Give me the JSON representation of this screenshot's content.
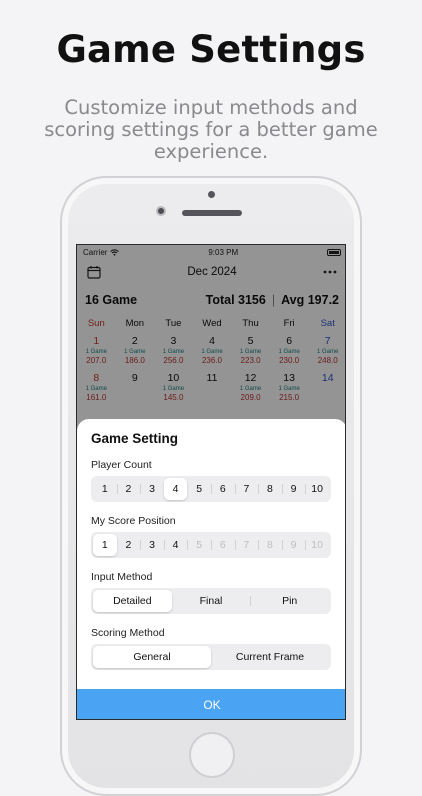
{
  "hero": {
    "title": "Game Settings",
    "subtitle": "Customize input methods and scoring settings for a better game experience."
  },
  "status_bar": {
    "carrier": "Carrier",
    "time": "9:03 PM"
  },
  "nav": {
    "month": "Dec 2024",
    "calendar_icon": "calendar-icon",
    "more_icon": "more-icon"
  },
  "summary": {
    "games": "16 Game",
    "total": "Total 3156",
    "separator": "|",
    "avg": "Avg 197.2"
  },
  "weekdays": [
    "Sun",
    "Mon",
    "Tue",
    "Wed",
    "Thu",
    "Fri",
    "Sat"
  ],
  "calendar_rows": [
    [
      {
        "day": "1",
        "games": "1 Game",
        "score": "207.0"
      },
      {
        "day": "2",
        "games": "1 Game",
        "score": "186.0"
      },
      {
        "day": "3",
        "games": "1 Game",
        "score": "256.0"
      },
      {
        "day": "4",
        "games": "1 Game",
        "score": "236.0"
      },
      {
        "day": "5",
        "games": "1 Game",
        "score": "223.0"
      },
      {
        "day": "6",
        "games": "1 Game",
        "score": "230.0"
      },
      {
        "day": "7",
        "games": "1 Game",
        "score": "248.0"
      }
    ],
    [
      {
        "day": "8",
        "games": "1 Game",
        "score": "161.0"
      },
      {
        "day": "9",
        "games": "",
        "score": ""
      },
      {
        "day": "10",
        "games": "1 Game",
        "score": "145.0"
      },
      {
        "day": "11",
        "games": "",
        "score": ""
      },
      {
        "day": "12",
        "games": "1 Game",
        "score": "209.0"
      },
      {
        "day": "13",
        "games": "1 Game",
        "score": "215.0"
      },
      {
        "day": "14",
        "games": "",
        "score": ""
      }
    ]
  ],
  "sheet": {
    "title": "Game Setting",
    "player_count": {
      "label": "Player Count",
      "options": [
        "1",
        "2",
        "3",
        "4",
        "5",
        "6",
        "7",
        "8",
        "9",
        "10"
      ],
      "selected": "4"
    },
    "score_position": {
      "label": "My Score Position",
      "options": [
        "1",
        "2",
        "3",
        "4",
        "5",
        "6",
        "7",
        "8",
        "9",
        "10"
      ],
      "selected": "1",
      "enabled_up_to": "4"
    },
    "input_method": {
      "label": "Input Method",
      "options": [
        "Detailed",
        "Final",
        "Pin"
      ],
      "selected": "Detailed"
    },
    "scoring_method": {
      "label": "Scoring Method",
      "options": [
        "General",
        "Current Frame"
      ],
      "selected": "General"
    },
    "ok_label": "OK"
  },
  "colors": {
    "accent": "#4aa3f3",
    "sunday": "#c0392b",
    "saturday": "#2a55c8",
    "game_count": "#1a7f7f",
    "score": "#b33333"
  }
}
